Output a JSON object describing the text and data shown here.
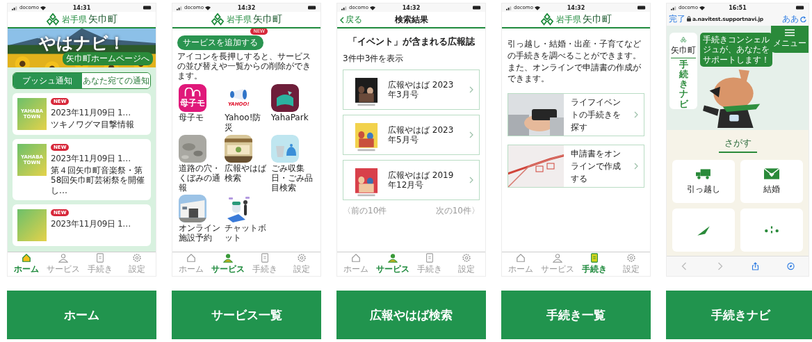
{
  "screens": [
    {
      "kind": "home",
      "status": {
        "carrier": "docomo",
        "time": "14:31"
      },
      "header": {
        "prefecture": "岩手県",
        "town": "矢巾町"
      },
      "banner": {
        "title": "やはナビ！",
        "link": "矢巾町ホームページへ"
      },
      "tabs": [
        {
          "label": "プッシュ通知",
          "selected": true
        },
        {
          "label": "あなた宛ての通知",
          "selected": false
        }
      ],
      "notices": [
        {
          "thumb": "YAHABA TOWN",
          "badge": "NEW",
          "date": "2023年11月09日 1…",
          "title": "ツキノワグマ目撃情報"
        },
        {
          "thumb": "YAHABA TOWN",
          "badge": "NEW",
          "date": "2023年11月09日 1…",
          "title": "第４回矢巾町音楽祭・第58回矢巾町芸術祭を開催し…"
        },
        {
          "badge": "NEW",
          "date": "2023年11月09日 1…"
        }
      ],
      "nav": [
        {
          "label": "ホーム",
          "selected": true
        },
        {
          "label": "サービス",
          "selected": false
        },
        {
          "label": "手続き",
          "selected": false
        },
        {
          "label": "設定",
          "selected": false
        }
      ]
    },
    {
      "kind": "services",
      "status": {
        "carrier": "docomo",
        "time": "14:32"
      },
      "header": {
        "prefecture": "岩手県",
        "town": "矢巾町"
      },
      "add_button": {
        "label": "サービスを追加する",
        "badge": "NEW"
      },
      "hint": "アイコンを長押しすると、サービスの並び替えや一覧からの削除ができます。",
      "services": [
        {
          "kind": "app",
          "label": "母子モ",
          "icon_text": "母子モ"
        },
        {
          "kind": "app",
          "label": "Yahoo!防災",
          "icon_text": "YAHOO!"
        },
        {
          "kind": "app",
          "label": "YahaPark"
        },
        {
          "label": "道路の穴・くぼみの通報"
        },
        {
          "label": "広報やはば検索"
        },
        {
          "kind": "app",
          "label": "ごみ収集日・ごみ品目検索"
        },
        {
          "label": "オンライン施設予約"
        },
        {
          "kind": "app",
          "label": "チャットボット"
        }
      ],
      "nav": [
        {
          "label": "ホーム",
          "selected": false
        },
        {
          "label": "サービス",
          "selected": true
        },
        {
          "label": "手続き",
          "selected": false
        },
        {
          "label": "設定",
          "selected": false
        }
      ]
    },
    {
      "kind": "search",
      "status": {
        "carrier": "docomo",
        "time": "14:32"
      },
      "appbar": {
        "back": "戻る",
        "title": "検索結果"
      },
      "heading": "「イベント」が含まれる広報誌",
      "count": "3件中3件を表示",
      "results": [
        {
          "title": "広報やはば 2023年3月号"
        },
        {
          "title": "広報やはば 2023年5月号"
        },
        {
          "title": "広報やはば 2019年12月号"
        }
      ],
      "pager": {
        "prev": "〈前の10件",
        "next": "次の10件〉"
      },
      "nav": [
        {
          "label": "ホーム",
          "selected": false
        },
        {
          "label": "サービス",
          "selected": true
        },
        {
          "label": "手続き",
          "selected": false
        },
        {
          "label": "設定",
          "selected": false
        }
      ]
    },
    {
      "kind": "procedures",
      "status": {
        "carrier": "docomo",
        "time": "14:32"
      },
      "header": {
        "prefecture": "岩手県",
        "town": "矢巾町"
      },
      "intro": "引っ越し・結婚・出産・子育てなどの手続きを調べることができます。また、オンラインで申請書の作成ができます。",
      "cards": [
        {
          "label": "ライフイベントの手続きを探す"
        },
        {
          "label": "申請書をオンラインで作成する"
        }
      ],
      "nav": [
        {
          "label": "ホーム",
          "selected": false
        },
        {
          "label": "サービス",
          "selected": false
        },
        {
          "label": "手続き",
          "selected": true
        },
        {
          "label": "設定",
          "selected": false
        }
      ]
    },
    {
      "kind": "navi",
      "status": {
        "carrier": "docomo",
        "time": "16:51"
      },
      "browser": {
        "done": "完了",
        "url": "a.navitest.supportnavi.jp",
        "text_size": "ああ"
      },
      "logo": {
        "town": "矢巾町",
        "title": "手続きナビ"
      },
      "bubble": "手続きコンシェルジュが、あなたをサポートします！",
      "menu": "メニュー",
      "section": "さがす",
      "tiles": [
        {
          "kind": "full",
          "label": "引っ越し"
        },
        {
          "kind": "full",
          "label": "結婚"
        },
        {
          "kind": "partial"
        },
        {
          "kind": "partial"
        }
      ]
    }
  ],
  "captions": [
    "ホーム",
    "サービス一覧",
    "広報やはば検索",
    "手続き一覧",
    "手続きナビ"
  ]
}
